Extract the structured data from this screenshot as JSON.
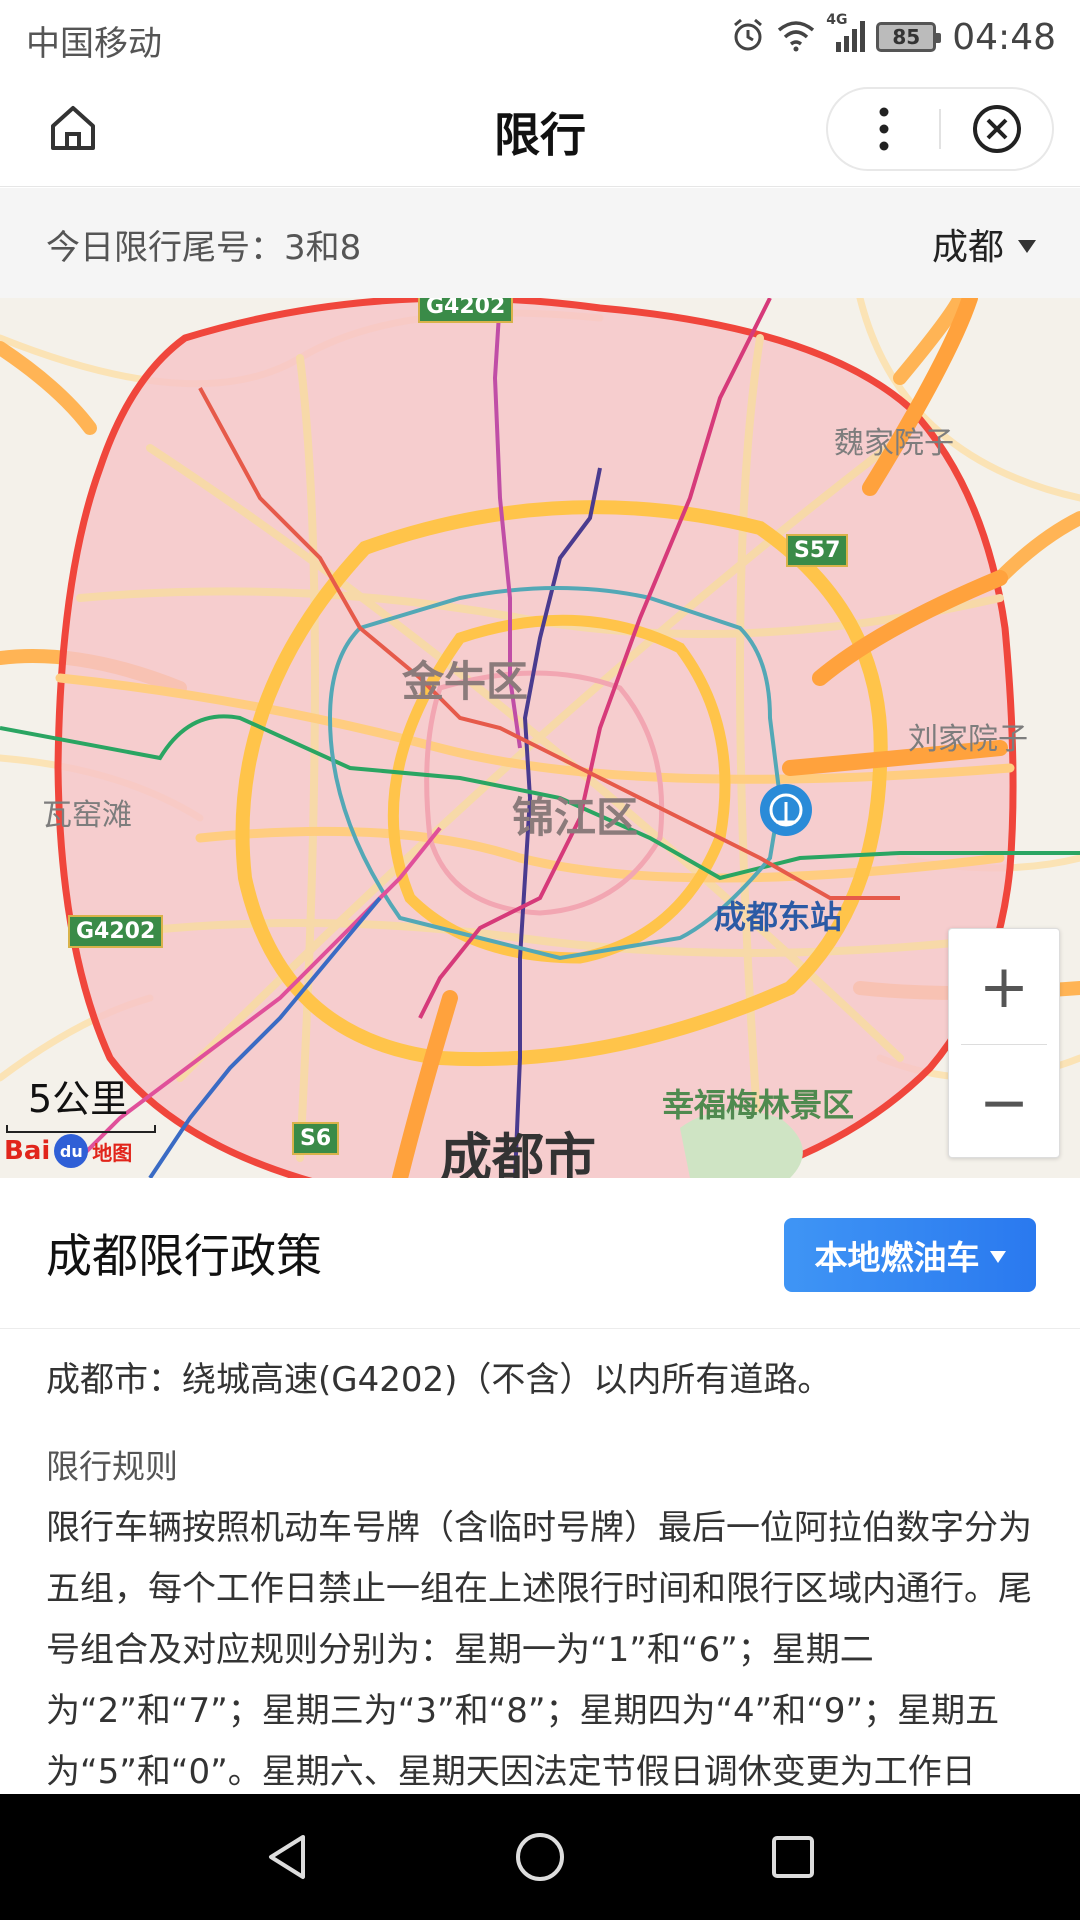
{
  "status_bar": {
    "carrier": "中国移动",
    "network": "4G",
    "battery": "85",
    "time": "04:48"
  },
  "header": {
    "title": "限行"
  },
  "info_bar": {
    "today_limit": "今日限行尾号：3和8",
    "city": "成都"
  },
  "map": {
    "labels": {
      "weijia": "魏家院子",
      "s57": "S57",
      "jinniu": "金牛区",
      "liujia": "刘家院子",
      "wayaotan": "瓦窑滩",
      "jinjiang": "锦江区",
      "g4202_west": "G4202",
      "g4202_north": "G4202",
      "chengdu_east_station": "成都东站",
      "meilin": "幸福梅林景区",
      "s6": "S6",
      "city": "成都市"
    },
    "scale": "5公里",
    "logo": "Bai",
    "logo_sub": "地图",
    "zoom_in": "+",
    "zoom_out": "−",
    "colors": {
      "zone_fill": "#f6c5c8",
      "zone_border": "#f0463c",
      "ring_road": "#ffc44a",
      "highway": "#ffa23d"
    }
  },
  "policy": {
    "title": "成都限行政策",
    "vehicle_type": "本地燃油车",
    "area": "成都市：绕城高速(G4202)（不含）以内所有道路。",
    "rule_heading": "限行规则",
    "rule_body": "限行车辆按照机动车号牌（含临时号牌）最后一位阿拉伯数字分为五组，每个工作日禁止一组在上述限行时间和限行区域内通行。尾号组合及对应规则分别为：星期一为“1”和“6”；星期二为“2”和“7”；星期三为“3”和“8”；星期四为“4”和“9”；星期五为“5”和“0”。星期六、星期天因法定节假日调休变更为工作日"
  }
}
